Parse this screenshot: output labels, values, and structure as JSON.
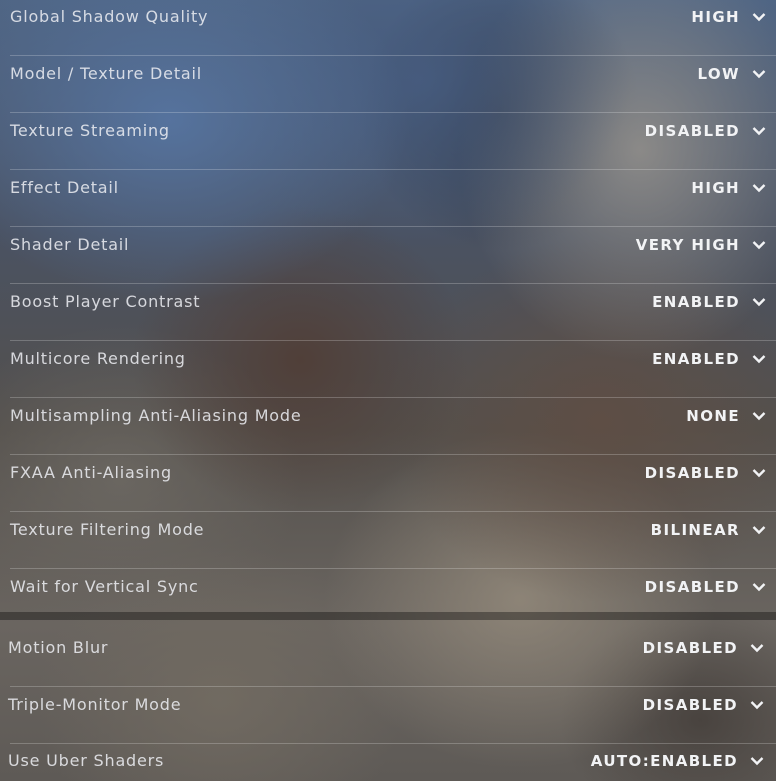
{
  "settings": [
    {
      "label": "Global Shadow Quality",
      "value": "HIGH"
    },
    {
      "label": "Model / Texture Detail",
      "value": "LOW"
    },
    {
      "label": "Texture Streaming",
      "value": "DISABLED"
    },
    {
      "label": "Effect Detail",
      "value": "HIGH"
    },
    {
      "label": "Shader Detail",
      "value": "VERY HIGH"
    },
    {
      "label": "Boost Player Contrast",
      "value": "ENABLED"
    },
    {
      "label": "Multicore Rendering",
      "value": "ENABLED"
    },
    {
      "label": "Multisampling Anti-Aliasing Mode",
      "value": "NONE"
    },
    {
      "label": "FXAA Anti-Aliasing",
      "value": "DISABLED"
    },
    {
      "label": "Texture Filtering Mode",
      "value": "BILINEAR"
    },
    {
      "label": "Wait for Vertical Sync",
      "value": "DISABLED"
    },
    {
      "label": "Motion Blur",
      "value": "DISABLED"
    },
    {
      "label": "Triple-Monitor Mode",
      "value": "DISABLED"
    },
    {
      "label": "Use Uber Shaders",
      "value": "AUTO:ENABLED"
    }
  ],
  "icons": {
    "dropdown": "chevron-down-icon"
  }
}
